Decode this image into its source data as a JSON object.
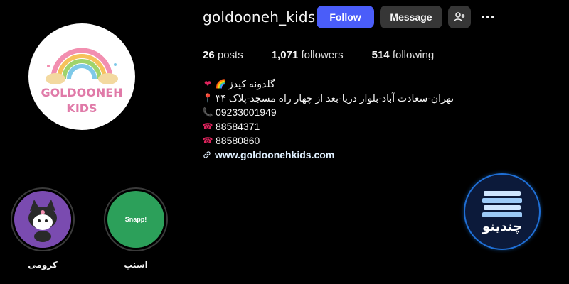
{
  "profile": {
    "username": "goldooneh_kids",
    "avatar_text_line1": "GOLDOONEH",
    "avatar_text_line2": "KIDS"
  },
  "actions": {
    "follow_label": "Follow",
    "message_label": "Message",
    "suggest_icon": "person-add-icon",
    "more_icon": "more-horizontal-icon"
  },
  "stats": {
    "posts_count": "26",
    "posts_label": "posts",
    "followers_count": "1,071",
    "followers_label": "followers",
    "following_count": "514",
    "following_label": "following"
  },
  "bio": {
    "name": "گلدونه کیدز",
    "address": "تهران-سعادت آباد-بلوار دریا-بعد از چهار راه مسجد-پلاک ۳۴",
    "phone_mobile": "09233001949",
    "phone_1": "88584371",
    "phone_2": "88580860",
    "website": "www.goldoonehkids.com"
  },
  "highlights": [
    {
      "label": "کرومی",
      "icon": "kuromi-image"
    },
    {
      "label": "اسنپ",
      "icon": "snapp-logo",
      "cover_text": "Snapp!",
      "cover_color": "#2ca05a"
    }
  ],
  "badge": {
    "text": "چندینو",
    "icon": "stack-icon",
    "color": "#1f6fd6"
  },
  "colors": {
    "background": "#000000",
    "follow_button": "#4a5df9",
    "secondary_button": "#363636"
  }
}
